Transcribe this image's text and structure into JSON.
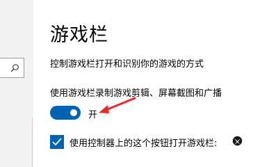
{
  "page": {
    "title": "游戏栏",
    "description": "控制游戏栏打开和识别你的游戏的方式"
  },
  "record_setting": {
    "label": "使用游戏栏录制游戏剪辑、屏幕截图和广播",
    "toggle_state_text": "开",
    "is_on": true
  },
  "controller_setting": {
    "label": "使用控制器上的这个按钮打开游戏栏:",
    "checked": true,
    "icon": "xbox-logo-icon"
  },
  "nav": {
    "search_icon": "search-icon"
  },
  "colors": {
    "accent": "#0063b1",
    "annotation_arrow": "#e8262d",
    "nav_background": "#f2f2f2"
  }
}
